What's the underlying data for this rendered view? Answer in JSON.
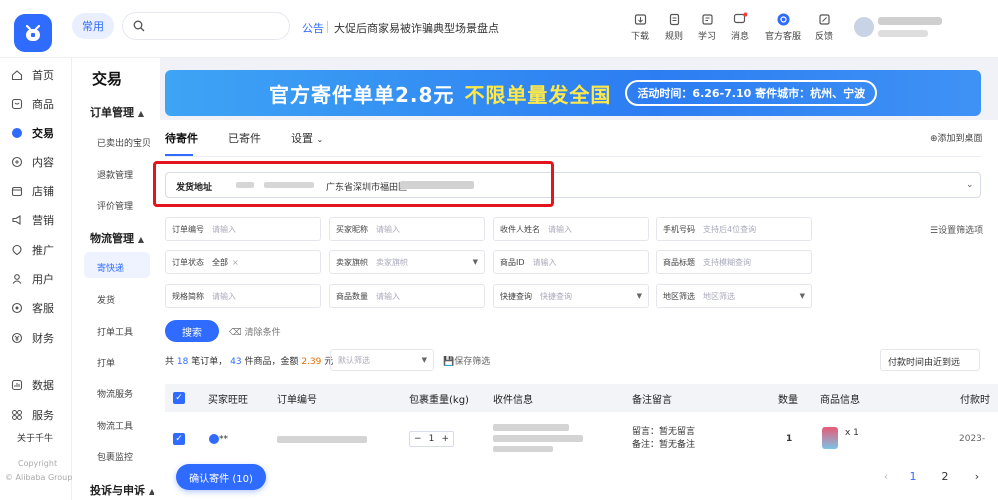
{
  "header": {
    "pill": "常用",
    "notice_tag": "公告",
    "notice_text": "大促后商家易被诈骗典型场景盘点",
    "icons": [
      {
        "label": "下载",
        "icon": "download-icon"
      },
      {
        "label": "规则",
        "icon": "rules-icon"
      },
      {
        "label": "学习",
        "icon": "learn-icon"
      },
      {
        "label": "消息",
        "icon": "message-icon"
      },
      {
        "label": "官方客服",
        "icon": "service-icon"
      },
      {
        "label": "反馈",
        "icon": "feedback-icon"
      }
    ]
  },
  "leftnav": {
    "items": [
      {
        "label": "首页",
        "icon": "home-icon"
      },
      {
        "label": "商品",
        "icon": "goods-icon"
      },
      {
        "label": "交易",
        "icon": "trade-icon"
      },
      {
        "label": "内容",
        "icon": "content-icon"
      },
      {
        "label": "店铺",
        "icon": "shop-icon"
      },
      {
        "label": "营销",
        "icon": "marketing-icon"
      },
      {
        "label": "推广",
        "icon": "promotion-icon"
      },
      {
        "label": "用户",
        "icon": "user-icon"
      },
      {
        "label": "客服",
        "icon": "customer-service-icon"
      },
      {
        "label": "财务",
        "icon": "finance-icon"
      },
      {
        "label": "数据",
        "icon": "data-icon"
      },
      {
        "label": "服务",
        "icon": "service-grid-icon"
      }
    ],
    "about": "关于千牛",
    "copyright": "Copyright",
    "company": "© Alibaba Group"
  },
  "submenu": {
    "title": "交易",
    "group1": "订单管理",
    "group1_items": [
      "已卖出的宝贝",
      "退款管理",
      "评价管理"
    ],
    "group2": "物流管理",
    "group2_items": [
      "寄快递",
      "发货",
      "打单工具",
      "打单",
      "物流服务",
      "物流工具",
      "包裹监控"
    ],
    "group3": "投诉与申诉"
  },
  "banner": {
    "text1": "官方寄件单单2.8元",
    "text2": "不限单量发全国",
    "chip": "活动时间：6.26-7.10  寄件城市：杭州、宁波"
  },
  "tabs": {
    "pending": "待寄件",
    "sent": "已寄件",
    "settings": "设置",
    "add_desktop": "添加到桌面"
  },
  "address": {
    "label": "发货地址",
    "value": "广东省深圳市福田区"
  },
  "filters": {
    "settings_link": "设置筛选项",
    "fields": [
      {
        "label": "订单编号",
        "placeholder": "请输入"
      },
      {
        "label": "买家昵称",
        "placeholder": "请输入"
      },
      {
        "label": "收件人姓名",
        "placeholder": "请输入"
      },
      {
        "label": "手机号码",
        "placeholder": "支持后4位查询"
      },
      {
        "label": "订单状态",
        "value": "全部"
      },
      {
        "label": "卖家旗帜",
        "placeholder": "卖家旗帜"
      },
      {
        "label": "商品ID",
        "placeholder": "请输入"
      },
      {
        "label": "商品标题",
        "placeholder": "支持模糊查询"
      },
      {
        "label": "规格简称",
        "placeholder": "请输入"
      },
      {
        "label": "商品数量",
        "placeholder": "请输入"
      },
      {
        "label": "快捷查询",
        "placeholder": "快捷查询"
      },
      {
        "label": "地区筛选",
        "placeholder": "地区筛选"
      }
    ],
    "search_btn": "搜索",
    "clear_btn": "清除条件"
  },
  "summary": {
    "prefix": "共",
    "orders": "18",
    "orders_unit": "笔订单，",
    "goods": "43",
    "goods_unit": "件商品，金额",
    "amount": "2.39",
    "amount_unit": "元",
    "default_filter": "默认筛选",
    "save_filter": "保存筛选",
    "sort": "付款时间由近到远"
  },
  "table": {
    "headers": [
      "买家旺旺",
      "订单编号",
      "包裹重量(kg)",
      "收件信息",
      "备注留言",
      "数量",
      "商品信息",
      "付款时"
    ],
    "row": {
      "buyer": "**",
      "weight": "1",
      "note1": "留言：暂无留言",
      "note2": "备注：暂无备注",
      "qty": "1",
      "goods_qty": "x 1",
      "paid": "2023-"
    }
  },
  "footer": {
    "confirm": "确认寄件 (10)",
    "pages": [
      "1",
      "2"
    ]
  },
  "colors": {
    "accent": "#2f6bff",
    "highlight_frame": "#e3141b"
  }
}
